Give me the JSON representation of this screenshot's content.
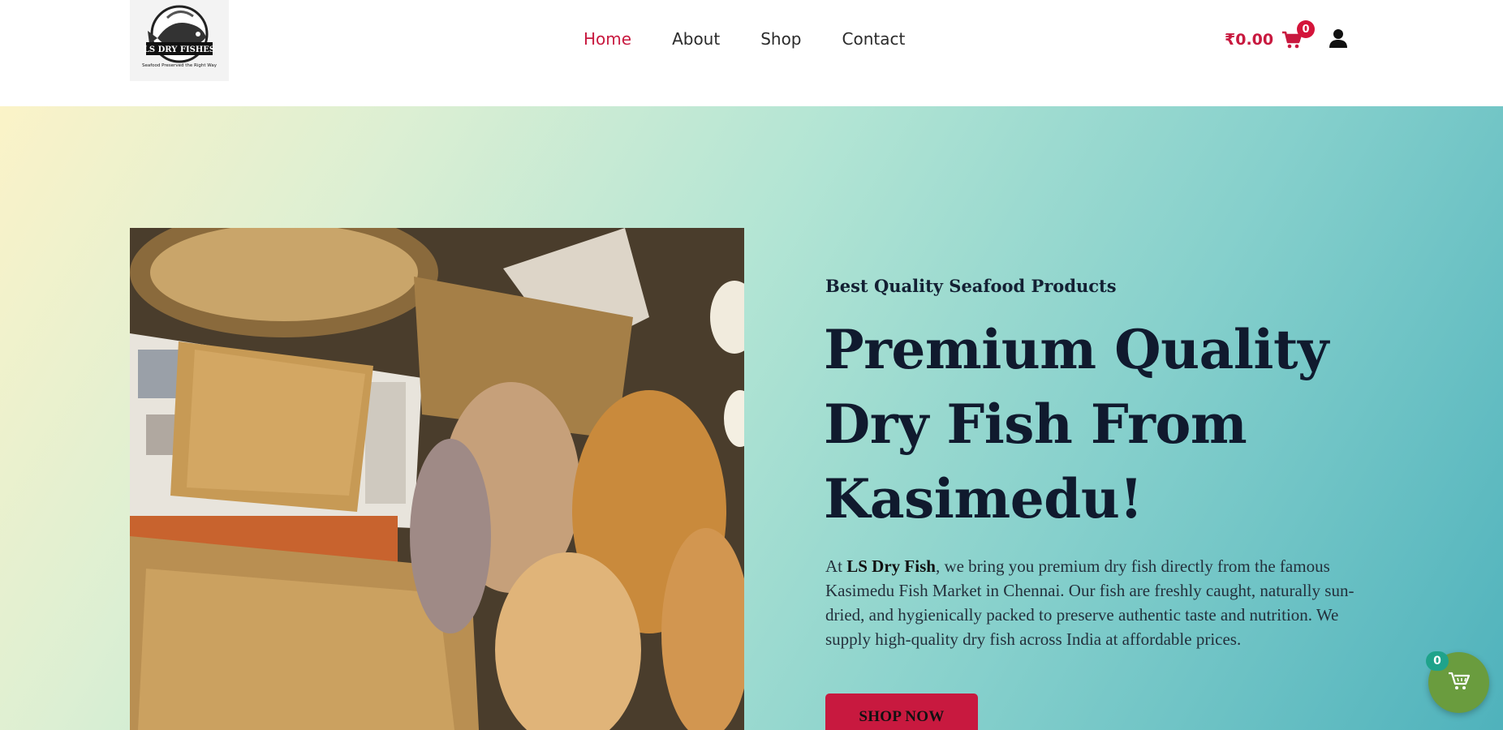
{
  "header": {
    "logo_text": "LS DRY FISHES",
    "logo_tagline": "Seafood Preserved the Right Way",
    "nav": [
      {
        "label": "Home",
        "active": true
      },
      {
        "label": "About",
        "active": false
      },
      {
        "label": "Shop",
        "active": false
      },
      {
        "label": "Contact",
        "active": false
      }
    ],
    "cart_total": "₹0.00",
    "cart_count": "0",
    "icons": {
      "cart": "cart-icon",
      "user": "user-icon"
    }
  },
  "hero": {
    "eyebrow": "Best Quality Seafood Products",
    "headline": "Premium Quality Dry Fish From Kasimedu!",
    "description_prefix": "At ",
    "description_brand": "LS Dry Fish",
    "description_rest": ", we bring you premium dry fish directly from the famous Kasimedu Fish Market in Chennai. Our fish are freshly caught, naturally sun-dried, and hygienically packed to preserve authentic taste and nutrition. We supply high-quality dry fish across India at affordable prices.",
    "cta_label": "SHOP NOW"
  },
  "floating_cart": {
    "count": "0",
    "icon": "cart-icon"
  },
  "colors": {
    "accent": "#c8193f",
    "heading": "#101a2e",
    "float_cart": "#6a9c3e",
    "float_badge": "#1fa38b"
  }
}
